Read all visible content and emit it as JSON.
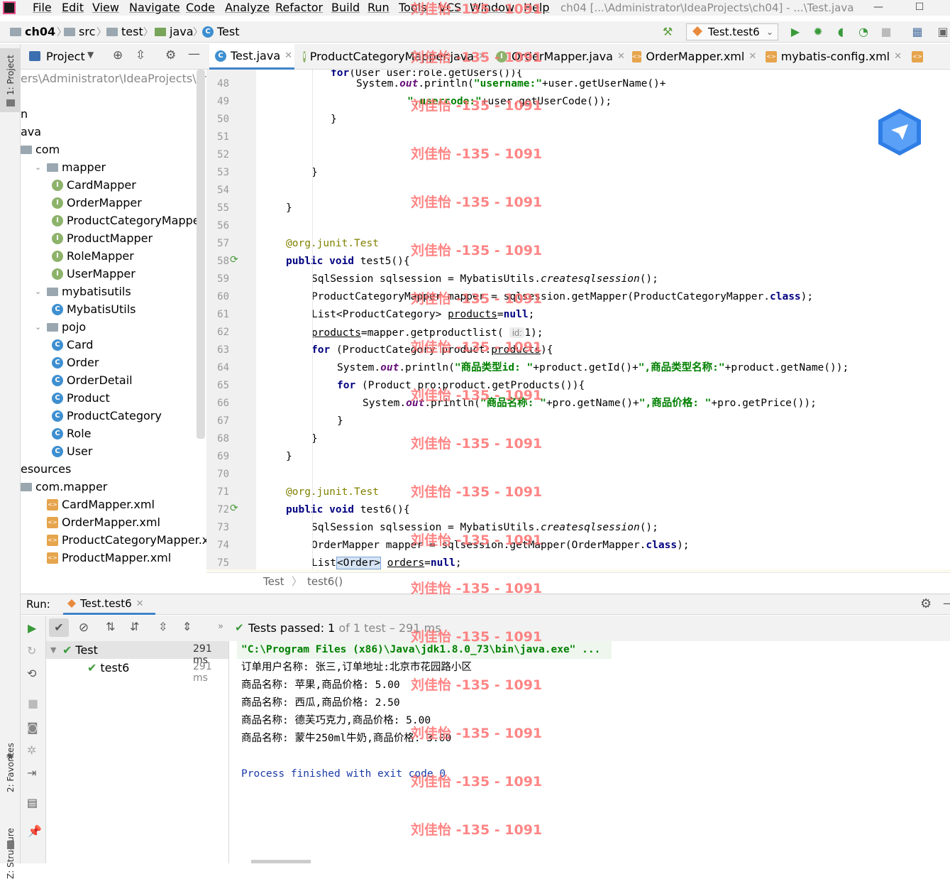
{
  "menu": {
    "items": [
      "File",
      "Edit",
      "View",
      "Navigate",
      "Code",
      "Analyze",
      "Refactor",
      "Build",
      "Run",
      "Tools",
      "VCS",
      "Window",
      "Help"
    ],
    "window_title": "ch04 [...\\Administrator\\IdeaProjects\\ch04] - ...\\Test.java"
  },
  "breadcrumb": {
    "project": "ch04",
    "src": "src",
    "test": "test",
    "java": "java",
    "file": "Test"
  },
  "run_config": {
    "label": "Test.test6"
  },
  "left_strip": {
    "project": "1: Project",
    "favorites": "2: Favorites",
    "structure": "Z: Structure"
  },
  "project_panel": {
    "title": "Project",
    "path": "ers\\Administrator\\IdeaProjects\\ch04"
  },
  "tree": [
    {
      "label": "n",
      "kind": "text",
      "indent": 0
    },
    {
      "label": "ava",
      "kind": "text",
      "indent": 0
    },
    {
      "label": "com",
      "kind": "pkg",
      "indent": 0
    },
    {
      "label": "mapper",
      "kind": "pkg",
      "indent": 1,
      "arrow": true
    },
    {
      "label": "CardMapper",
      "kind": "iface",
      "indent": 2
    },
    {
      "label": "OrderMapper",
      "kind": "iface",
      "indent": 2
    },
    {
      "label": "ProductCategoryMapper",
      "kind": "iface",
      "indent": 2
    },
    {
      "label": "ProductMapper",
      "kind": "iface",
      "indent": 2
    },
    {
      "label": "RoleMapper",
      "kind": "iface",
      "indent": 2
    },
    {
      "label": "UserMapper",
      "kind": "iface",
      "indent": 2
    },
    {
      "label": "mybatisutils",
      "kind": "pkg",
      "indent": 1,
      "arrow": true
    },
    {
      "label": "MybatisUtils",
      "kind": "class",
      "indent": 2
    },
    {
      "label": "pojo",
      "kind": "pkg",
      "indent": 1,
      "arrow": true
    },
    {
      "label": "Card",
      "kind": "class",
      "indent": 2
    },
    {
      "label": "Order",
      "kind": "class",
      "indent": 2
    },
    {
      "label": "OrderDetail",
      "kind": "class",
      "indent": 2
    },
    {
      "label": "Product",
      "kind": "class",
      "indent": 2
    },
    {
      "label": "ProductCategory",
      "kind": "class",
      "indent": 2
    },
    {
      "label": "Role",
      "kind": "class",
      "indent": 2
    },
    {
      "label": "User",
      "kind": "class",
      "indent": 2
    },
    {
      "label": "esources",
      "kind": "text",
      "indent": 0
    },
    {
      "label": "com.mapper",
      "kind": "pkg",
      "indent": 0
    },
    {
      "label": "CardMapper.xml",
      "kind": "xml",
      "indent": 1
    },
    {
      "label": "OrderMapper.xml",
      "kind": "xml",
      "indent": 1
    },
    {
      "label": "ProductCategoryMapper.xml",
      "kind": "xml",
      "indent": 1
    },
    {
      "label": "ProductMapper.xml",
      "kind": "xml",
      "indent": 1
    }
  ],
  "tabs": [
    {
      "label": "Test.java",
      "icon": "class",
      "active": true
    },
    {
      "label": "ProductCategoryMapper.java",
      "icon": "iface"
    },
    {
      "label": "OrderMapper.java",
      "icon": "iface"
    },
    {
      "label": "OrderMapper.xml",
      "icon": "xml"
    },
    {
      "label": "mybatis-config.xml",
      "icon": "xml"
    }
  ],
  "editor": {
    "line_numbers": [
      "48",
      "49",
      "50",
      "51",
      "52",
      "53",
      "54",
      "55",
      "56",
      "57",
      "58",
      "59",
      "60",
      "61",
      "62",
      "63",
      "64",
      "65",
      "66",
      "67",
      "68",
      "69",
      "70",
      "71",
      "72",
      "73",
      "74",
      "75"
    ],
    "crumbs": [
      "Test",
      "test6()"
    ]
  },
  "run": {
    "label": "Run:",
    "tab": "Test.test6",
    "status": "Tests passed:",
    "passed": "1",
    "of": "of 1 test – 291 ms",
    "tree": [
      {
        "label": "Test",
        "time": "291 ms"
      },
      {
        "label": "test6",
        "time": "291 ms"
      }
    ],
    "console": [
      "\"C:\\Program Files (x86)\\Java\\jdk1.8.0_73\\bin\\java.exe\" ...",
      "订单用户名称: 张三,订单地址:北京市花园路小区",
      "商品名称: 苹果,商品价格: 5.00",
      "商品名称: 西瓜,商品价格: 2.50",
      "商品名称: 德芙巧克力,商品价格: 5.00",
      "商品名称: 蒙牛250ml牛奶,商品价格: 3.00",
      "",
      "Process finished with exit code 0"
    ]
  },
  "watermark": "刘佳怡 -135 - 1091",
  "colors": {
    "accent": "#4083c9",
    "string": "#008000",
    "keyword": "#000080",
    "watermark": "#ff7070"
  }
}
